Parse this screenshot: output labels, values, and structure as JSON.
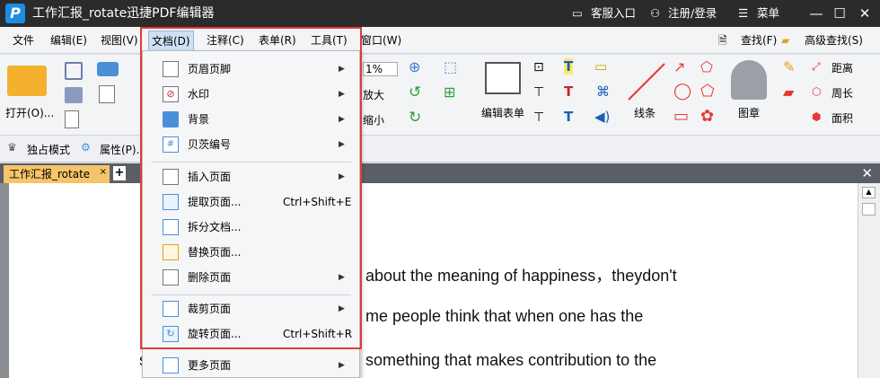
{
  "window": {
    "title": "工作汇报_rotate迅捷PDF编辑器",
    "logo_letter": "P",
    "service_label": "客服入口",
    "login_label": "注册/登录",
    "menu_label": "菜单",
    "minimize_glyph": "—",
    "maximize_glyph": "☐",
    "close_glyph": "✕"
  },
  "menubar": {
    "items": [
      "文件",
      "编辑(E)",
      "视图(V)",
      "文档(D)",
      "注释(C)",
      "表单(R)",
      "工具(T)",
      "窗口(W)"
    ],
    "active": "文档(D)",
    "find_label": "查找(F)",
    "adv_find_label": "高级查找(S)"
  },
  "ribbon": {
    "open_label": "打开(O)...",
    "zoom_value": "1%",
    "zoom_in_label": "放大",
    "zoom_out_label": "缩小",
    "edit_form_label": "编辑表单",
    "line_label": "线条",
    "stamp_label": "图章",
    "distance_label": "距离",
    "perimeter_label": "周长",
    "area_label": "面积"
  },
  "toolbar2": {
    "exclusive_mode_label": "独占模式",
    "properties_label": "属性(P)..."
  },
  "tabs": {
    "doc_tab_label": "工作汇报_rotate",
    "close_glyph": "×",
    "new_tab_glyph": "+",
    "panel_close_glyph": "✕"
  },
  "document": {
    "lines": [
      "about the meaning of happiness，theydon't",
      "me  people  think  that  when  one  has  the",
      "something  that  makes  contribution  to  the"
    ],
    "left_fragments": [
      "k",
      "s"
    ]
  },
  "dropdown": {
    "items": [
      {
        "label": "页眉页脚",
        "icon": "header-footer-icon",
        "submenu": true,
        "shortcut": ""
      },
      {
        "label": "水印",
        "icon": "watermark-icon",
        "submenu": true,
        "shortcut": ""
      },
      {
        "label": "背景",
        "icon": "background-icon",
        "submenu": true,
        "shortcut": ""
      },
      {
        "label": "贝茨编号",
        "icon": "bates-number-icon",
        "submenu": true,
        "shortcut": ""
      },
      {
        "label": "插入页面",
        "icon": "insert-page-icon",
        "submenu": true,
        "shortcut": ""
      },
      {
        "label": "提取页面...",
        "icon": "extract-page-icon",
        "submenu": false,
        "shortcut": "Ctrl+Shift+E"
      },
      {
        "label": "拆分文档...",
        "icon": "split-document-icon",
        "submenu": false,
        "shortcut": ""
      },
      {
        "label": "替换页面...",
        "icon": "replace-page-icon",
        "submenu": false,
        "shortcut": ""
      },
      {
        "label": "删除页面",
        "icon": "delete-page-icon",
        "submenu": true,
        "shortcut": ""
      },
      {
        "label": "裁剪页面",
        "icon": "crop-page-icon",
        "submenu": true,
        "shortcut": ""
      },
      {
        "label": "旋转页面...",
        "icon": "rotate-page-icon",
        "submenu": false,
        "shortcut": "Ctrl+Shift+R"
      },
      {
        "label": "更多页面",
        "icon": "more-pages-icon",
        "submenu": true,
        "shortcut": ""
      }
    ],
    "arrow_glyph": "▶"
  },
  "colors": {
    "titlebar": "#2b2b2b",
    "highlight": "#e53935",
    "menu_active": "#cfe0f5",
    "tab_active": "#f7c46a"
  }
}
